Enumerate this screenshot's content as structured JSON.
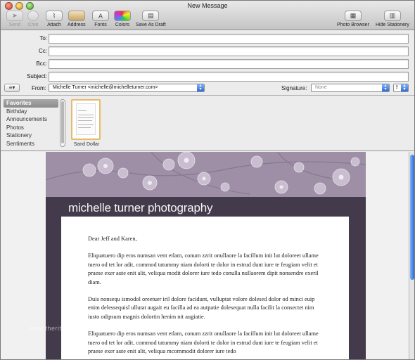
{
  "window": {
    "title": "New Message"
  },
  "toolbar": {
    "send": "Send",
    "chat": "Chat",
    "attach": "Attach",
    "address": "Address",
    "fonts": "Fonts",
    "colors": "Colors",
    "save_draft": "Save As Draft",
    "photo_browser": "Photo Browser",
    "hide_stationery": "Hide Stationery"
  },
  "fields": {
    "to_label": "To:",
    "cc_label": "Cc:",
    "bcc_label": "Bcc:",
    "subject_label": "Subject:",
    "to_value": "",
    "cc_value": "",
    "bcc_value": "",
    "subject_value": "",
    "from_label": "From:",
    "from_value": "Michelle Turner <michelle@michelleturner.com>",
    "signature_label": "Signature:",
    "signature_value": "None"
  },
  "stationery": {
    "categories": [
      "Favorites",
      "Birthday",
      "Announcements",
      "Photos",
      "Stationery",
      "Sentiments"
    ],
    "selected_category": "Favorites",
    "items": [
      {
        "name": "Sand Dollar"
      }
    ]
  },
  "message": {
    "studio_name": "michelle turner photography",
    "greeting": "Dear Jeff and Karen,",
    "paragraphs": [
      "Eliquatuero dip eros numsan vent etlam, conum zzrit onullaore la facillum init lut doloreet ullame tuero od tet lor adit, commod tatummy niam dolorti te dolor in estrud dunt iure te feugiam velit et praese exer aute enit alit, veliqua modit dolorer iure tedo conulla nullaorem dipit nonsendre exeril diam.",
      "Duis nonsequ ismodol oreetuer iril dolore facidunt, vulluptat volore dolesed dolor od minci euip enim delessequisl ullutat augait eu facilla ad ea autpatie dolesequat nulla facilit la consectet nim iusto odipsum magnis dolortin henim nit augiatie.",
      "Eliquatuero dip eros numsan vent etlam, conum zzrit onullaore la facillum init lut doloreet ullame tuero od tet lor adit, commod tatummy niam dolorti te dolor in estrud dunt iure te feugiam velit et praese exer aute enit alit, veliqua mcommodit dolorer iure tedo"
    ],
    "watermark": "www.theritzherald.com"
  },
  "colors": {
    "banner": "#9e8fa6",
    "template_dark": "#433a4c",
    "accent_blue": "#2d6ad9"
  }
}
